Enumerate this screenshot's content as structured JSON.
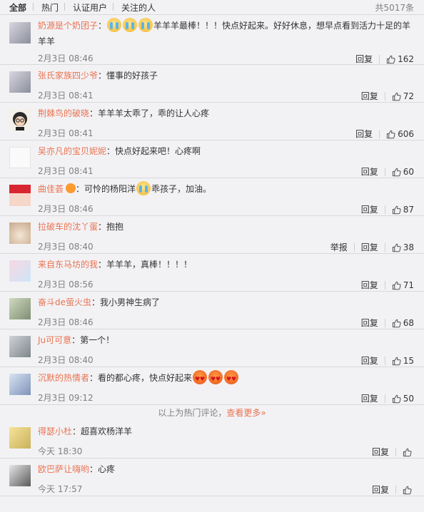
{
  "tabs": [
    {
      "label": "全部",
      "active": true
    },
    {
      "label": "热门",
      "active": false
    },
    {
      "label": "认证用户",
      "active": false
    },
    {
      "label": "关注的人",
      "active": false
    }
  ],
  "total": "共5017条",
  "reply_label": "回复",
  "report_label": "举报",
  "colors": {
    "username": "#eb7350",
    "meta": "#808080",
    "background": "#f2f2f5",
    "divider": "#d9d9d9"
  },
  "comments": [
    {
      "user": "奶源是个奶团子",
      "text_before": "：",
      "emoji_before": [
        "crying",
        "crying",
        "crying"
      ],
      "text": "羊羊羊最棒！！！快点好起来。好好休息，想早点看到活力十足的羊羊羊",
      "emoji_after": [],
      "time": "2月3日 08:46",
      "likes": "162",
      "report": false,
      "avatar": "avatar-photo"
    },
    {
      "user": "张氏家族四少爷",
      "text_before": "：",
      "emoji_before": [],
      "text": "懂事的好孩子",
      "emoji_after": [],
      "time": "2月3日 08:41",
      "likes": "72",
      "report": false,
      "avatar": "avatar-photo"
    },
    {
      "user": "荆棘鸟的破晓",
      "text_before": "：",
      "emoji_before": [],
      "text": "羊羊羊太乖了，乖的让人心疼",
      "emoji_after": [],
      "time": "2月3日 08:41",
      "likes": "606",
      "report": false,
      "avatar": "avatar-cartoon"
    },
    {
      "user": "吴亦凡的宝贝妮妮",
      "text_before": "：",
      "emoji_before": [],
      "text": "快点好起来吧！心疼啊",
      "emoji_after": [],
      "time": "2月3日 08:41",
      "likes": "60",
      "report": false,
      "avatar": "avatar-blank"
    },
    {
      "user": "曲佳荟",
      "badge": true,
      "text_before": "：可怜的杨阳洋",
      "emoji_before": [
        "crying"
      ],
      "text": "乖孩子，加油。",
      "emoji_after": [],
      "time": "2月3日 08:46",
      "likes": "87",
      "report": false,
      "avatar": "avatar-girl"
    },
    {
      "user": "拉破车的沈丫蛋",
      "text_before": "：",
      "emoji_before": [],
      "text": "抱抱",
      "emoji_after": [],
      "time": "2月3日 08:40",
      "likes": "38",
      "report": true,
      "avatar": "avatar-dog"
    },
    {
      "user": "来自东马坊的我",
      "text_before": "：",
      "emoji_before": [],
      "text": "羊羊羊，真棒！！！！",
      "emoji_after": [],
      "time": "2月3日 08:56",
      "likes": "71",
      "report": false,
      "avatar": "avatar-pastel"
    },
    {
      "user": "奋斗de萤火虫",
      "text_before": "：",
      "emoji_before": [],
      "text": "我小男神生病了",
      "emoji_after": [],
      "time": "2月3日 08:46",
      "likes": "68",
      "report": false,
      "avatar": "avatar-green"
    },
    {
      "user": "Ju可可意",
      "text_before": "：",
      "emoji_before": [],
      "text": "第一个！",
      "emoji_after": [],
      "time": "2月3日 08:40",
      "likes": "15",
      "report": false,
      "avatar": "avatar-grey"
    },
    {
      "user": "沉默的热情者",
      "text_before": "：",
      "emoji_before": [],
      "text": "看的都心疼，快点好起来",
      "emoji_after": [
        "heart",
        "heart",
        "heart"
      ],
      "time": "2月3日 09:12",
      "likes": "50",
      "report": false,
      "avatar": "avatar-anime"
    }
  ],
  "hot_divider": {
    "text": "以上为热门评论，",
    "more": "查看更多»"
  },
  "latest": [
    {
      "user": "得瑟小杜",
      "text_before": "：",
      "text": "超喜欢杨洋羊",
      "time": "今天 18:30",
      "avatar": "avatar-yellow"
    },
    {
      "user": "欧巴萨让嗨哟",
      "text_before": "：",
      "text": "心疼",
      "time": "今天 17:57",
      "avatar": "avatar-bw"
    }
  ]
}
